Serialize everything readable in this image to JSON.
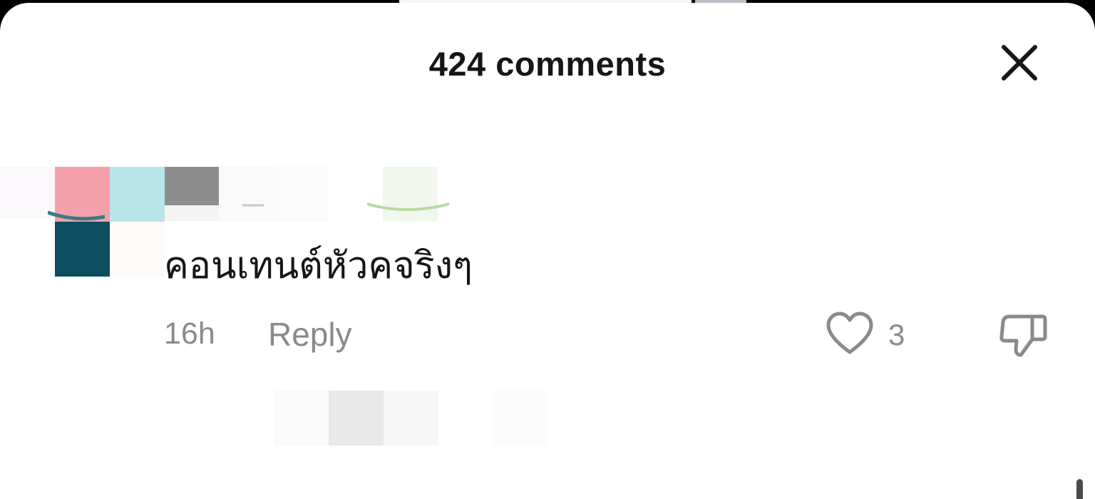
{
  "comments_panel": {
    "title": "424 comments",
    "close_icon": "close-icon"
  },
  "comment": {
    "text": "คอนเทนต์หัวคจริงๆ",
    "time": "16h",
    "reply_label": "Reply",
    "like_count": "3",
    "like_icon": "heart-outline-icon",
    "dislike_icon": "thumbs-down-outline-icon"
  },
  "colors": {
    "text_primary": "#161616",
    "text_secondary": "#8a8a8a",
    "background": "#ffffff"
  }
}
